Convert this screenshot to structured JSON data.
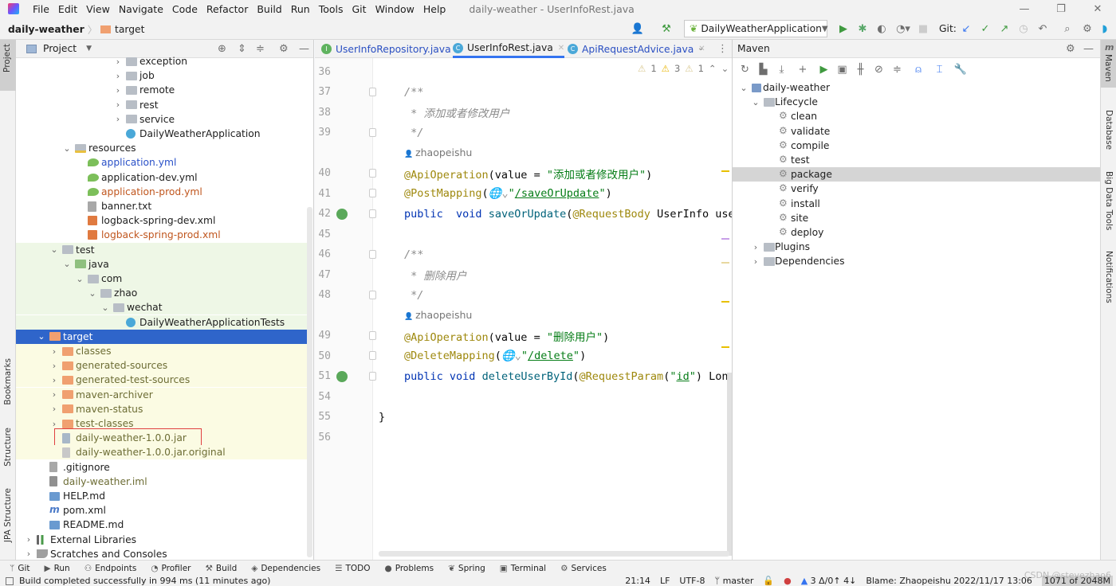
{
  "menu": {
    "items": [
      "File",
      "Edit",
      "View",
      "Navigate",
      "Code",
      "Refactor",
      "Build",
      "Run",
      "Tools",
      "Git",
      "Window",
      "Help"
    ],
    "window_title": "daily-weather - UserInfoRest.java"
  },
  "breadcrumb": {
    "project": "daily-weather",
    "folder": "target"
  },
  "toolbar": {
    "run_config": "DailyWeatherApplication",
    "git_label": "Git:"
  },
  "left_strip": {
    "project": "Project",
    "bookmarks": "Bookmarks",
    "structure": "Structure",
    "jpa": "JPA Structure"
  },
  "right_strip": {
    "maven": "Maven",
    "database": "Database",
    "bigdata": "Big Data Tools",
    "notifications": "Notifications"
  },
  "project_panel": {
    "title": "Project",
    "rows": [
      {
        "label": "exception",
        "depth": 7,
        "kind": "pkg",
        "expander": ">"
      },
      {
        "label": "job",
        "depth": 7,
        "kind": "pkg",
        "expander": ">"
      },
      {
        "label": "remote",
        "depth": 7,
        "kind": "pkg",
        "expander": ">"
      },
      {
        "label": "rest",
        "depth": 7,
        "kind": "pkg",
        "expander": ">"
      },
      {
        "label": "service",
        "depth": 7,
        "kind": "pkg",
        "expander": ">"
      },
      {
        "label": "DailyWeatherApplication",
        "depth": 7,
        "kind": "spring-class"
      },
      {
        "label": "resources",
        "depth": 3,
        "kind": "res",
        "expander": "v"
      },
      {
        "label": "application.yml",
        "depth": 4,
        "kind": "yml",
        "color": "#2a51c8"
      },
      {
        "label": "application-dev.yml",
        "depth": 4,
        "kind": "yml"
      },
      {
        "label": "application-prod.yml",
        "depth": 4,
        "kind": "yml",
        "color": "#c0561e"
      },
      {
        "label": "banner.txt",
        "depth": 4,
        "kind": "txt"
      },
      {
        "label": "logback-spring-dev.xml",
        "depth": 4,
        "kind": "xml"
      },
      {
        "label": "logback-spring-prod.xml",
        "depth": 4,
        "kind": "xml",
        "color": "#c0561e"
      },
      {
        "label": "test",
        "depth": 2,
        "kind": "folder",
        "expander": "v",
        "bg": "test"
      },
      {
        "label": "java",
        "depth": 3,
        "kind": "src-test",
        "expander": "v",
        "bg": "test"
      },
      {
        "label": "com",
        "depth": 4,
        "kind": "pkg",
        "expander": "v",
        "bg": "test"
      },
      {
        "label": "zhao",
        "depth": 5,
        "kind": "pkg",
        "expander": "v",
        "bg": "test"
      },
      {
        "label": "wechat",
        "depth": 6,
        "kind": "pkg",
        "expander": "v",
        "bg": "test"
      },
      {
        "label": "DailyWeatherApplicationTests",
        "depth": 7,
        "kind": "spring-class",
        "bg": "test"
      },
      {
        "label": "target",
        "depth": 1,
        "kind": "excluded",
        "expander": "v",
        "selected": true
      },
      {
        "label": "classes",
        "depth": 2,
        "kind": "excluded",
        "expander": ">",
        "bg": "target",
        "color": "#6d6d35"
      },
      {
        "label": "generated-sources",
        "depth": 2,
        "kind": "excluded",
        "expander": ">",
        "bg": "target",
        "color": "#6d6d35"
      },
      {
        "label": "generated-test-sources",
        "depth": 2,
        "kind": "excluded",
        "expander": ">",
        "bg": "target",
        "color": "#6d6d35"
      },
      {
        "label": "maven-archiver",
        "depth": 2,
        "kind": "excluded",
        "expander": ">",
        "bg": "target",
        "color": "#6d6d35"
      },
      {
        "label": "maven-status",
        "depth": 2,
        "kind": "excluded",
        "expander": ">",
        "bg": "target",
        "color": "#6d6d35"
      },
      {
        "label": "test-classes",
        "depth": 2,
        "kind": "excluded",
        "expander": ">",
        "bg": "target",
        "color": "#6d6d35"
      },
      {
        "label": "daily-weather-1.0.0.jar",
        "depth": 2,
        "kind": "jar",
        "bg": "target",
        "color": "#6d6d35",
        "highlight": true
      },
      {
        "label": "daily-weather-1.0.0.jar.original",
        "depth": 2,
        "kind": "unknown",
        "bg": "target",
        "color": "#6d6d35"
      },
      {
        "label": ".gitignore",
        "depth": 1,
        "kind": "ignore"
      },
      {
        "label": "daily-weather.iml",
        "depth": 1,
        "kind": "iml",
        "color": "#6d6d35"
      },
      {
        "label": "HELP.md",
        "depth": 1,
        "kind": "md"
      },
      {
        "label": "pom.xml",
        "depth": 1,
        "kind": "maven"
      },
      {
        "label": "README.md",
        "depth": 1,
        "kind": "md"
      },
      {
        "label": "External Libraries",
        "depth": 0,
        "kind": "lib",
        "expander": ">"
      },
      {
        "label": "Scratches and Consoles",
        "depth": 0,
        "kind": "scratch",
        "expander": ">"
      }
    ]
  },
  "editor": {
    "tabs": [
      {
        "label": "UserInfoRepository.java",
        "badge": "I",
        "badge_color": "#5fb35f"
      },
      {
        "label": "UserInfoRest.java",
        "badge": "C",
        "badge_color": "#4aa8d8",
        "active": true
      },
      {
        "label": "ApiRequestAdvice.java",
        "badge": "C",
        "badge_color": "#4aa8d8"
      }
    ],
    "inspections": {
      "weak_warnings_a": "1",
      "warnings": "3",
      "weak_warnings_b": "1"
    },
    "lines": [
      {
        "num": "36",
        "indent": 0,
        "tokens": []
      },
      {
        "num": "37",
        "indent": 1,
        "tokens": [
          {
            "t": "/**",
            "c": "cmt"
          }
        ]
      },
      {
        "num": "38",
        "indent": 1,
        "tokens": [
          {
            "t": " * 添加或者修改用户",
            "c": "cmt"
          }
        ]
      },
      {
        "num": "39",
        "indent": 1,
        "tokens": [
          {
            "t": " */",
            "c": "cmt"
          }
        ]
      },
      {
        "num": "",
        "indent": 1,
        "author": "zhaopeishu",
        "tokens": []
      },
      {
        "num": "40",
        "indent": 1,
        "tokens": [
          {
            "t": "@ApiOperation",
            "c": "ann"
          },
          {
            "t": "(value = ",
            "c": "pl"
          },
          {
            "t": "\"添加或者修改用户\"",
            "c": "str"
          },
          {
            "t": ")",
            "c": "pl"
          }
        ]
      },
      {
        "num": "41",
        "indent": 1,
        "tokens": [
          {
            "t": "@PostMapping",
            "c": "ann"
          },
          {
            "t": "(",
            "c": "pl"
          },
          {
            "t": "🌐⌄",
            "c": "cmt"
          },
          {
            "t": "\"",
            "c": "str"
          },
          {
            "t": "/saveOrUpdate",
            "c": "str und"
          },
          {
            "t": "\"",
            "c": "str"
          },
          {
            "t": ")",
            "c": "pl"
          }
        ]
      },
      {
        "num": "42",
        "indent": 1,
        "gutter_icon": true,
        "tokens": [
          {
            "t": "public",
            "c": "kw"
          },
          {
            "t": "  ",
            "c": "pl"
          },
          {
            "t": "void",
            "c": "kw"
          },
          {
            "t": " ",
            "c": "pl"
          },
          {
            "t": "saveOrUpdate",
            "c": "fn"
          },
          {
            "t": "(",
            "c": "pl"
          },
          {
            "t": "@RequestBody",
            "c": "ann"
          },
          {
            "t": " UserInfo user",
            "c": "pl"
          }
        ]
      },
      {
        "num": "45",
        "indent": 0,
        "tokens": []
      },
      {
        "num": "46",
        "indent": 1,
        "tokens": [
          {
            "t": "/**",
            "c": "cmt"
          }
        ]
      },
      {
        "num": "47",
        "indent": 1,
        "tokens": [
          {
            "t": " * 删除用户",
            "c": "cmt"
          }
        ]
      },
      {
        "num": "48",
        "indent": 1,
        "tokens": [
          {
            "t": " */",
            "c": "cmt"
          }
        ]
      },
      {
        "num": "",
        "indent": 1,
        "author": "zhaopeishu",
        "tokens": []
      },
      {
        "num": "49",
        "indent": 1,
        "tokens": [
          {
            "t": "@ApiOperation",
            "c": "ann"
          },
          {
            "t": "(value = ",
            "c": "pl"
          },
          {
            "t": "\"删除用户\"",
            "c": "str"
          },
          {
            "t": ")",
            "c": "pl"
          }
        ]
      },
      {
        "num": "50",
        "indent": 1,
        "tokens": [
          {
            "t": "@DeleteMapping",
            "c": "ann"
          },
          {
            "t": "(",
            "c": "pl"
          },
          {
            "t": "🌐⌄",
            "c": "cmt"
          },
          {
            "t": "\"",
            "c": "str"
          },
          {
            "t": "/delete",
            "c": "str und"
          },
          {
            "t": "\"",
            "c": "str"
          },
          {
            "t": ")",
            "c": "pl"
          }
        ]
      },
      {
        "num": "51",
        "indent": 1,
        "gutter_icon": true,
        "tokens": [
          {
            "t": "public",
            "c": "kw"
          },
          {
            "t": " ",
            "c": "pl"
          },
          {
            "t": "void",
            "c": "kw"
          },
          {
            "t": " ",
            "c": "pl"
          },
          {
            "t": "deleteUserById",
            "c": "fn"
          },
          {
            "t": "(",
            "c": "pl"
          },
          {
            "t": "@RequestParam",
            "c": "ann"
          },
          {
            "t": "(",
            "c": "pl"
          },
          {
            "t": "\"",
            "c": "str"
          },
          {
            "t": "id",
            "c": "str und"
          },
          {
            "t": "\"",
            "c": "str"
          },
          {
            "t": ") Long",
            "c": "pl"
          }
        ]
      },
      {
        "num": "54",
        "indent": 0,
        "tokens": []
      },
      {
        "num": "55",
        "indent": 0,
        "tokens": [
          {
            "t": "}",
            "c": "pl"
          }
        ]
      },
      {
        "num": "56",
        "indent": 0,
        "tokens": []
      }
    ]
  },
  "maven": {
    "title": "Maven",
    "rows": [
      {
        "label": "daily-weather",
        "level": 0,
        "expander": "v",
        "kind": "module"
      },
      {
        "label": "Lifecycle",
        "level": 1,
        "expander": "v",
        "kind": "folder"
      },
      {
        "label": "clean",
        "level": 2,
        "kind": "goal"
      },
      {
        "label": "validate",
        "level": 2,
        "kind": "goal"
      },
      {
        "label": "compile",
        "level": 2,
        "kind": "goal"
      },
      {
        "label": "test",
        "level": 2,
        "kind": "goal"
      },
      {
        "label": "package",
        "level": 2,
        "kind": "goal",
        "selected": true
      },
      {
        "label": "verify",
        "level": 2,
        "kind": "goal"
      },
      {
        "label": "install",
        "level": 2,
        "kind": "goal"
      },
      {
        "label": "site",
        "level": 2,
        "kind": "goal"
      },
      {
        "label": "deploy",
        "level": 2,
        "kind": "goal"
      },
      {
        "label": "Plugins",
        "level": 1,
        "expander": ">",
        "kind": "folder"
      },
      {
        "label": "Dependencies",
        "level": 1,
        "expander": ">",
        "kind": "folder"
      }
    ]
  },
  "bottom_tools": [
    {
      "label": "Git",
      "icon": "ᛘ"
    },
    {
      "label": "Run",
      "icon": "▶"
    },
    {
      "label": "Endpoints",
      "icon": "⚇"
    },
    {
      "label": "Profiler",
      "icon": "◔"
    },
    {
      "label": "Build",
      "icon": "⚒"
    },
    {
      "label": "Dependencies",
      "icon": "◈"
    },
    {
      "label": "TODO",
      "icon": "☰"
    },
    {
      "label": "Problems",
      "icon": "●"
    },
    {
      "label": "Spring",
      "icon": "❦"
    },
    {
      "label": "Terminal",
      "icon": "▣"
    },
    {
      "label": "Services",
      "icon": "⚙"
    }
  ],
  "status": {
    "message": "Build completed successfully in 994 ms (11 minutes ago)",
    "position": "21:14",
    "line_sep": "LF",
    "encoding": "UTF-8",
    "branch": "master",
    "git_changes": "3 Δ/0↑ 4↓",
    "blame": "Blame: Zhaopeishu 2022/11/17 13:06",
    "memory": "1071 of 2048M",
    "watermark": "CSDN @stevezhao6"
  },
  "colors": {
    "selection": "#2f65ca",
    "accent": "#3574f0",
    "test_bg": "#eef7e6",
    "target_bg": "#fbfbe3",
    "highlight_box": "#e04040"
  }
}
